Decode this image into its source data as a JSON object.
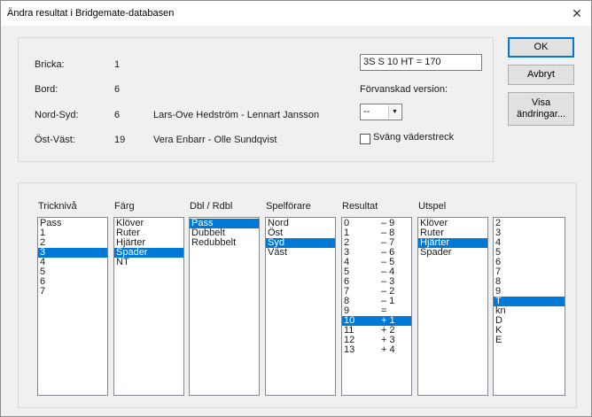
{
  "window": {
    "title": "Ändra resultat i Bridgemate-databasen",
    "close": "✕"
  },
  "info": {
    "board_label": "Bricka:",
    "board_value": "1",
    "table_label": "Bord:",
    "table_value": "6",
    "ns_label": "Nord-Syd:",
    "ns_value": "6",
    "ns_names": "Lars-Ove Hedström - Lennart Jansson",
    "ew_label": "Öst-Väst:",
    "ew_value": "19",
    "ew_names": "Vera Enbarr - Olle Sundqvist",
    "result_text": "3S S 10 HT = 170",
    "corrupted_label": "Förvanskad version:",
    "corrupted_value": "--",
    "swap_label": "Sväng väderstreck",
    "swap_checked": false
  },
  "buttons": {
    "ok": "OK",
    "cancel": "Avbryt",
    "show_changes_line1": "Visa",
    "show_changes_line2": "ändringar..."
  },
  "lists": {
    "level": {
      "header": "Tricknivå",
      "items": [
        "Pass",
        "1",
        "2",
        "3",
        "4",
        "5",
        "6",
        "7"
      ],
      "selected": 3
    },
    "color": {
      "header": "Färg",
      "items": [
        "Klöver",
        "Ruter",
        "Hjärter",
        "Spader",
        "NT"
      ],
      "selected": 3
    },
    "dbl": {
      "header": "Dbl / Rdbl",
      "items": [
        "Pass",
        "Dubbelt",
        "Redubbelt"
      ],
      "selected": 0
    },
    "declarer": {
      "header": "Spelförare",
      "items": [
        "Nord",
        "Öst",
        "Syd",
        "Väst"
      ],
      "selected": 2
    },
    "result": {
      "header": "Resultat",
      "items": [
        {
          "a": "0",
          "b": "– 9"
        },
        {
          "a": "1",
          "b": "– 8"
        },
        {
          "a": "2",
          "b": "– 7"
        },
        {
          "a": "3",
          "b": "– 6"
        },
        {
          "a": "4",
          "b": "– 5"
        },
        {
          "a": "5",
          "b": "– 4"
        },
        {
          "a": "6",
          "b": "– 3"
        },
        {
          "a": "7",
          "b": "– 2"
        },
        {
          "a": "8",
          "b": "– 1"
        },
        {
          "a": "9",
          "b": "="
        },
        {
          "a": "10",
          "b": "+ 1"
        },
        {
          "a": "11",
          "b": "+ 2"
        },
        {
          "a": "12",
          "b": "+ 3"
        },
        {
          "a": "13",
          "b": "+ 4"
        }
      ],
      "selected": 10
    },
    "lead_suit": {
      "header": "Utspel",
      "items": [
        "Klöver",
        "Ruter",
        "Hjärter",
        "Spader"
      ],
      "selected": 2
    },
    "lead_card": {
      "items": [
        "2",
        "3",
        "4",
        "5",
        "6",
        "7",
        "8",
        "9",
        "T",
        "kn",
        "D",
        "K",
        "E"
      ],
      "selected": 8
    }
  },
  "colors": {
    "selection": "#0078d7",
    "default_button_border": "#0078d7"
  }
}
